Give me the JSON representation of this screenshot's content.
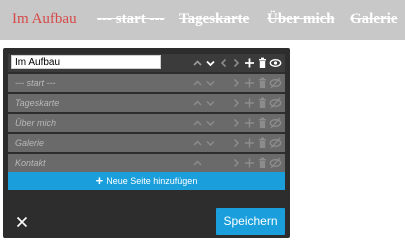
{
  "nav": {
    "items": [
      {
        "label": "Im Aufbau"
      },
      {
        "label": "--- start ---"
      },
      {
        "label": "Tageskarte"
      },
      {
        "label": "Über mich"
      },
      {
        "label": "Galerie"
      }
    ]
  },
  "editor": {
    "current_page_value": "Im Aufbau",
    "pages": [
      {
        "label": "--- start ---"
      },
      {
        "label": "Tageskarte"
      },
      {
        "label": "Über mich"
      },
      {
        "label": "Galerie"
      },
      {
        "label": "Kontakt"
      }
    ],
    "add_page_label": "Neue Seite hinzufügen",
    "save_label": "Speichern"
  },
  "colors": {
    "accent": "#1a9fdc",
    "active_nav": "#d44a48",
    "panel_bg": "#2d2d2d",
    "row_bg": "#6a6a6a",
    "nav_bg": "#c8c8c8"
  },
  "icons": {
    "row_actions": [
      "chevron-up-icon",
      "chevron-down-icon",
      "chevron-left-icon",
      "chevron-right-icon",
      "plus-icon",
      "trash-icon",
      "eye-icon"
    ],
    "close": "close-icon"
  }
}
